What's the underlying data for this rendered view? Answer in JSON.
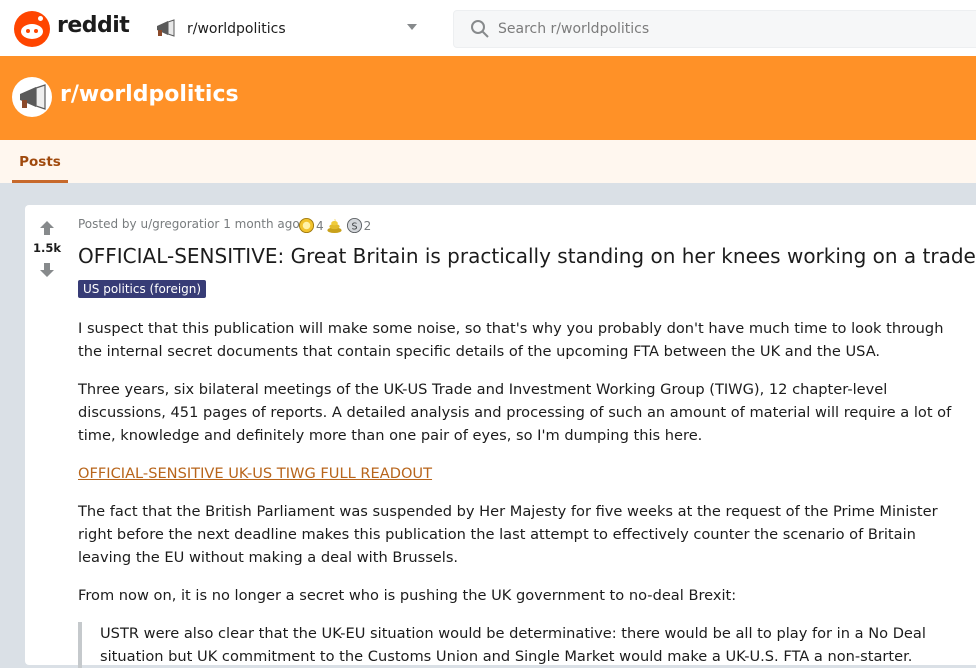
{
  "header": {
    "wordmark": "reddit",
    "subreddit_selector": "r/worldpolitics",
    "search_placeholder": "Search r/worldpolitics"
  },
  "banner": {
    "title": "r/worldpolitics"
  },
  "tabs": {
    "posts_label": "Posts"
  },
  "post": {
    "vote_count": "1.5k",
    "meta_prefix": "Posted by ",
    "author": "u/gregoratior",
    "time": "1 month ago",
    "awards": [
      {
        "icon": "gold-award-icon",
        "count": "4"
      },
      {
        "icon": "poop-award-icon",
        "count": ""
      },
      {
        "icon": "silver-award-icon",
        "count": "2"
      }
    ],
    "title": "OFFICIAL-SENSITIVE: Great Britain is practically standing on her knees working on a trade",
    "flair": "US politics (foreign)",
    "paragraphs": [
      "I suspect that this publication will make some noise, so that's why you probably don't have much time to look through the internal secret documents that contain specific details of the upcoming FTA between the UK and the USA.",
      "Three years, six bilateral meetings of the UK-US Trade and Investment Working Group (TIWG), 12 chapter-level discussions, 451 pages of reports. A detailed analysis and processing of such an amount of material will require a lot of time, knowledge and definitely more than one pair of eyes, so I'm dumping this here.",
      "The fact that the British Parliament was suspended by Her Majesty for five weeks at the request of the Prime Minister right before the next deadline makes this publication the last attempt to effectively counter the scenario of Britain leaving the EU without making a deal with Brussels.",
      "From now on, it is no longer a secret who is pushing the UK government to no-deal Brexit:"
    ],
    "link_text": "OFFICIAL-SENSITIVE UK-US TIWG FULL READOUT",
    "quote": "USTR were also clear that the UK-EU situation would be determinative: there would be all to play for in a No Deal situation but UK commitment to the Customs Union and Single Market would make a UK-U.S. FTA a non-starter."
  },
  "colors": {
    "brand": "#ff4500",
    "banner": "#ff9127",
    "tab_active": "#a04a0e",
    "flair_bg": "#373c76",
    "link": "#b8651b"
  }
}
